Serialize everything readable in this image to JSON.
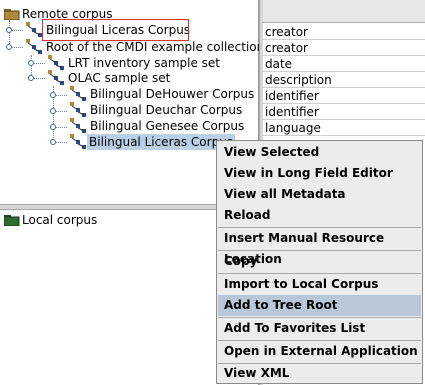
{
  "remote_tree": {
    "root_label": "Remote corpus",
    "nodes": [
      {
        "label": "Bilingual Liceras Corpus",
        "highlighted": true
      },
      {
        "label": "Root of the CMDI example collection"
      },
      {
        "label": "LRT inventory sample set"
      },
      {
        "label": "OLAC sample set"
      },
      {
        "label": "Bilingual DeHouwer Corpus"
      },
      {
        "label": "Bilingual Deuchar Corpus"
      },
      {
        "label": "Bilingual Genesee Corpus"
      },
      {
        "label": "Bilingual Liceras Corpus",
        "selected": true
      }
    ]
  },
  "local_tree": {
    "root_label": "Local corpus"
  },
  "metadata_fields": [
    "creator",
    "creator",
    "date",
    "description",
    "identifier",
    "identifier",
    "language"
  ],
  "context_menu": {
    "items": [
      {
        "label": "View Selected"
      },
      {
        "label": "View in Long Field Editor"
      },
      {
        "label": "View all Metadata"
      },
      {
        "label": "Reload"
      },
      {
        "label": "Insert Manual Resource Location"
      },
      {
        "label": "Copy"
      },
      {
        "label": "Import to Local Corpus"
      },
      {
        "label": "Add to Tree Root",
        "hovered": true
      },
      {
        "label": "Add To Favorites List"
      },
      {
        "label": "Open in External Application"
      },
      {
        "label": "View XML"
      }
    ]
  },
  "colors": {
    "selection": "#b8cfe5",
    "highlight_box": "#d63232",
    "menu_hover": "#b8c8d8",
    "folder_green": "#2f6b2f"
  },
  "icons": [
    "folder-icon",
    "corpus-node-icon",
    "tree-handle-icon"
  ]
}
